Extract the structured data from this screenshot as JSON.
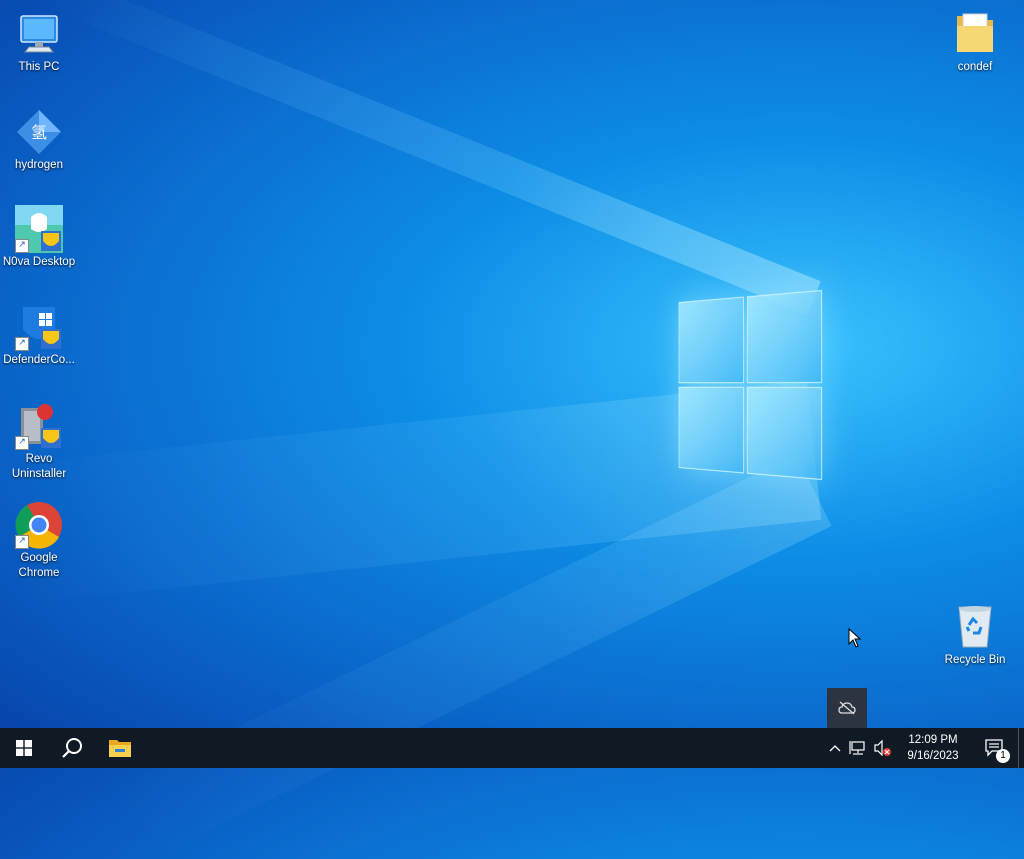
{
  "desktop": {
    "icons": [
      {
        "label": "This PC",
        "icon": "this-pc-icon"
      },
      {
        "label": "hydrogen",
        "icon": "hydrogen-icon",
        "glyph": "氢"
      },
      {
        "label": "N0va Desktop",
        "icon": "n0va-desktop-icon"
      },
      {
        "label": "DefenderCo...",
        "icon": "defender-control-icon"
      },
      {
        "label": "Revo Uninstaller",
        "icon": "revo-uninstaller-icon"
      },
      {
        "label": "Google Chrome",
        "icon": "chrome-icon"
      },
      {
        "label": "condef",
        "icon": "folder-icon"
      },
      {
        "label": "Recycle Bin",
        "icon": "recycle-bin-icon"
      }
    ]
  },
  "taskbar": {
    "start": "windows-start-icon",
    "search": "search-icon",
    "pinned": [
      "file-explorer-icon"
    ],
    "tray": {
      "icons": [
        "chevron-up-icon",
        "network-icon",
        "volume-muted-icon"
      ],
      "time": "12:09 PM",
      "date": "9/16/2023",
      "notifications_count": "1"
    }
  },
  "colors": {
    "taskbar_bg": "#0f1a24",
    "wallpaper_accent": "#39c3ff"
  }
}
